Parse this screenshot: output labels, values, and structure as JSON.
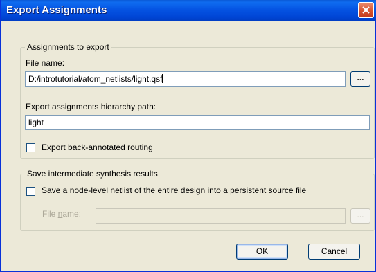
{
  "dialog": {
    "title": "Export Assignments"
  },
  "assignments": {
    "legend": "Assignments to export",
    "file_name_label": "File name:",
    "file_name_value": "D:/introtutorial/atom_netlists/light.qsf",
    "browse_label": "...",
    "hierarchy_label": "Export assignments hierarchy path:",
    "hierarchy_value": "light",
    "back_annotated_label": "Export back-annotated routing"
  },
  "synthesis": {
    "legend": "Save intermediate synthesis results",
    "netlist_checkbox_label": "Save a node-level netlist of the entire design into a persistent source file",
    "file_name_label_prefix": "File ",
    "file_name_label_accel": "n",
    "file_name_label_suffix": "ame:",
    "file_name_value": "",
    "browse_label": "..."
  },
  "buttons": {
    "ok_prefix": "",
    "ok_accel": "O",
    "ok_suffix": "K",
    "cancel": "Cancel"
  },
  "colors": {
    "titlebar": "#0554e3",
    "face": "#ece9d8",
    "close": "#d6532e"
  }
}
